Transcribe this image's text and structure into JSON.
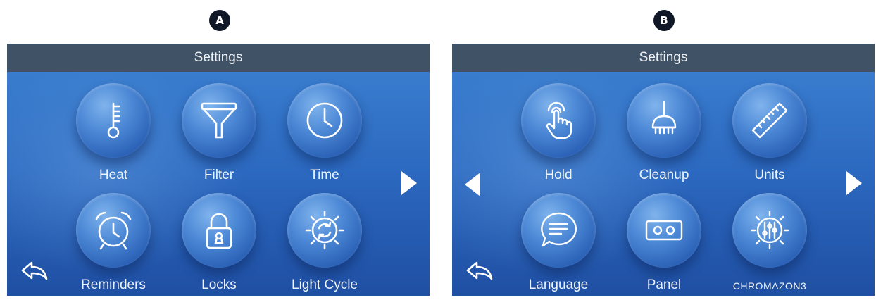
{
  "panel_a": {
    "badge": "A",
    "title": "Settings",
    "tiles": [
      {
        "label": "Heat",
        "icon": "thermometer-icon"
      },
      {
        "label": "Filter",
        "icon": "filter-icon"
      },
      {
        "label": "Time",
        "icon": "clock-icon"
      },
      {
        "label": "Reminders",
        "icon": "alarm-clock-icon"
      },
      {
        "label": "Locks",
        "icon": "padlock-icon"
      },
      {
        "label": "Light Cycle",
        "icon": "light-cycle-icon"
      }
    ]
  },
  "panel_b": {
    "badge": "B",
    "title": "Settings",
    "tiles": [
      {
        "label": "Hold",
        "icon": "touch-hand-icon"
      },
      {
        "label": "Cleanup",
        "icon": "broom-icon"
      },
      {
        "label": "Units",
        "icon": "ruler-icon"
      },
      {
        "label": "Language",
        "icon": "speech-bubble-icon"
      },
      {
        "label": "Panel",
        "icon": "panel-icon"
      },
      {
        "label": "CHROMAZON3",
        "icon": "chromazone-icon"
      }
    ]
  },
  "colors": {
    "title_bar": "#3f5266",
    "screen_top": "#3d82d2",
    "screen_bottom": "#1f4fa3",
    "icon_stroke": "#ffffff"
  }
}
